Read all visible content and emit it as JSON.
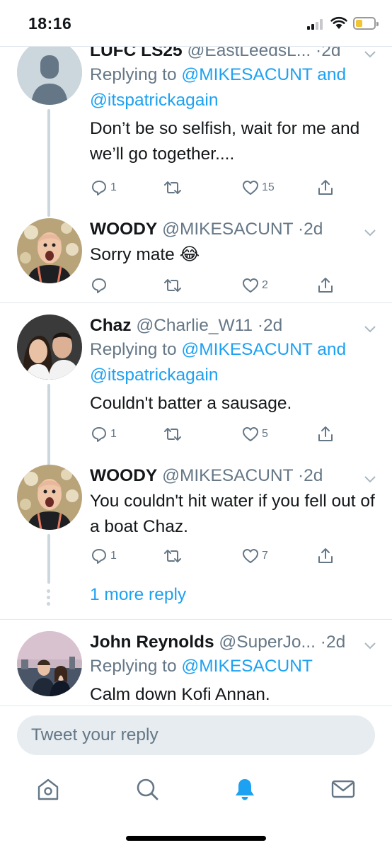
{
  "status_bar": {
    "time": "18:16"
  },
  "tweets": [
    {
      "name": "LUFC LS25",
      "handle": "@EastLeedsL...",
      "time": "2d",
      "reply_prefix": "Replying to",
      "reply_to_1": "@MIKESACUNT",
      "reply_and": "and",
      "reply_to_2": "@itspatrickagain",
      "text": "Don’t be so selfish, wait for me and we’ll go together....",
      "replies": "1",
      "retweets": "",
      "likes": "15"
    },
    {
      "name": "WOODY",
      "handle": "@MIKESACUNT",
      "time": "2d",
      "text": "Sorry mate 😂",
      "replies": "",
      "retweets": "",
      "likes": "2"
    },
    {
      "name": "Chaz",
      "handle": "@Charlie_W11",
      "time": "2d",
      "reply_prefix": "Replying to",
      "reply_to_1": "@MIKESACUNT",
      "reply_and": "and",
      "reply_to_2": "@itspatrickagain",
      "text": "Couldn't batter a sausage.",
      "replies": "1",
      "retweets": "",
      "likes": "5"
    },
    {
      "name": "WOODY",
      "handle": "@MIKESACUNT",
      "time": "2d",
      "text": "You couldn't hit water if you fell out of a boat Chaz.",
      "replies": "1",
      "retweets": "",
      "likes": "7"
    },
    {
      "name": "John Reynolds",
      "handle": "@SuperJo...",
      "time": "2d",
      "reply_prefix": "Replying to",
      "reply_to_1": "@MIKESACUNT",
      "text": "Calm down Kofi Annan."
    }
  ],
  "more_replies": "1 more reply",
  "composer": {
    "placeholder": "Tweet your reply"
  },
  "tab_bar": {
    "items": [
      {
        "icon": "home-icon",
        "active": false
      },
      {
        "icon": "search-icon",
        "active": false
      },
      {
        "icon": "notifications-icon",
        "active": true
      },
      {
        "icon": "messages-icon",
        "active": false
      }
    ]
  },
  "colors": {
    "accent": "#1da1f2",
    "text": "#14171a",
    "secondary": "#657786",
    "divider": "#e1e8ed",
    "thread_line": "#ccd6dd"
  }
}
